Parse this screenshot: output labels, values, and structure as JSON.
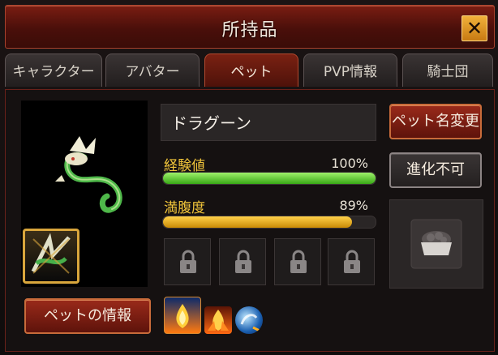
{
  "window": {
    "title": "所持品"
  },
  "tabs": [
    {
      "label": "キャラクター"
    },
    {
      "label": "アバター"
    },
    {
      "label": "ペット"
    },
    {
      "label": "PVP情報"
    },
    {
      "label": "騎士団"
    }
  ],
  "pet": {
    "name": "ドラグーン",
    "stats": {
      "exp": {
        "label": "経験値",
        "value_text": "100%",
        "fraction": 1.0
      },
      "fullness": {
        "label": "満腹度",
        "value_text": "89%",
        "fraction": 0.89
      }
    },
    "locked_slots": 4
  },
  "buttons": {
    "rename": "ペット名変更",
    "evolve": "進化不可",
    "info": "ペットの情報"
  },
  "colors": {
    "accent": "#7a1d12",
    "exp_bar": "#5cd32a",
    "fullness_bar": "#f2b81c",
    "label_gold": "#f0c43a"
  },
  "icons": [
    "close-icon",
    "pet-dragon-image",
    "pet-thumbnail-icon",
    "lock-icon",
    "food-bowl-icon",
    "fire-skill-icon",
    "flame-burst-skill-icon",
    "water-orb-skill-icon"
  ]
}
